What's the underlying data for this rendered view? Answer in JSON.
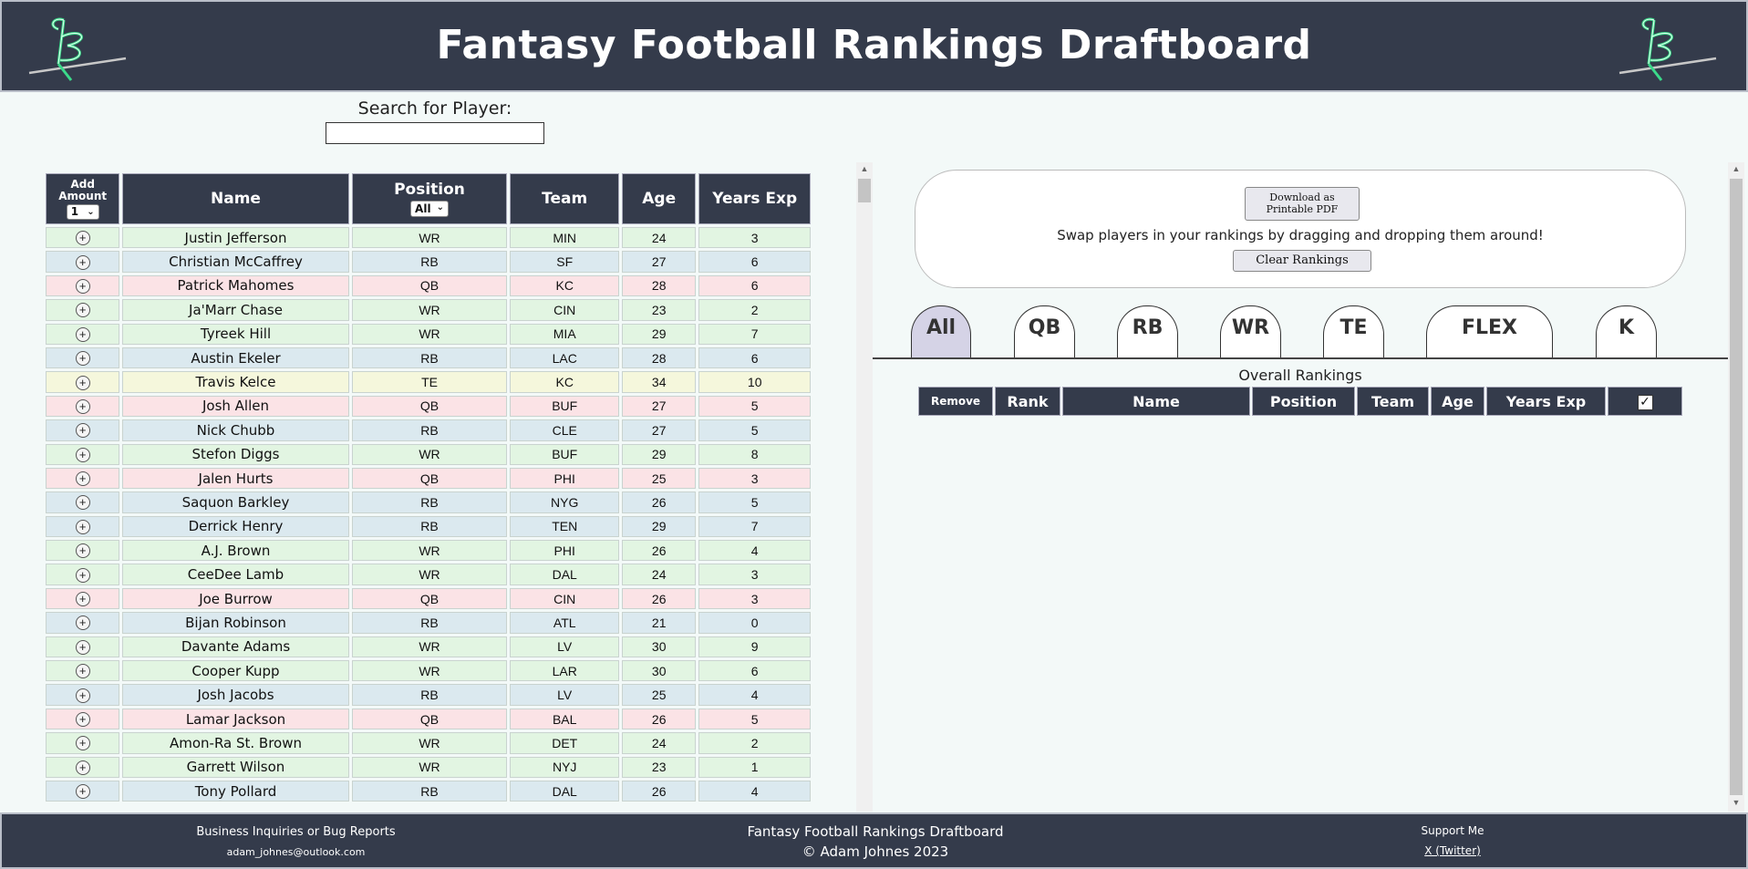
{
  "header": {
    "title": "Fantasy Football Rankings Draftboard"
  },
  "search": {
    "label": "Search for Player:",
    "value": "",
    "placeholder": ""
  },
  "player_table": {
    "headers": {
      "add_line1": "Add",
      "add_line2": "Amount",
      "name": "Name",
      "position": "Position",
      "team": "Team",
      "age": "Age",
      "years_exp": "Years Exp"
    },
    "add_amount_value": "1",
    "position_filter_value": "All",
    "add_icon": "plus-circle-icon",
    "rows": [
      {
        "name": "Justin Jefferson",
        "position": "WR",
        "team": "MIN",
        "age": "24",
        "exp": "3"
      },
      {
        "name": "Christian McCaffrey",
        "position": "RB",
        "team": "SF",
        "age": "27",
        "exp": "6"
      },
      {
        "name": "Patrick Mahomes",
        "position": "QB",
        "team": "KC",
        "age": "28",
        "exp": "6"
      },
      {
        "name": "Ja'Marr Chase",
        "position": "WR",
        "team": "CIN",
        "age": "23",
        "exp": "2"
      },
      {
        "name": "Tyreek Hill",
        "position": "WR",
        "team": "MIA",
        "age": "29",
        "exp": "7"
      },
      {
        "name": "Austin Ekeler",
        "position": "RB",
        "team": "LAC",
        "age": "28",
        "exp": "6"
      },
      {
        "name": "Travis Kelce",
        "position": "TE",
        "team": "KC",
        "age": "34",
        "exp": "10"
      },
      {
        "name": "Josh Allen",
        "position": "QB",
        "team": "BUF",
        "age": "27",
        "exp": "5"
      },
      {
        "name": "Nick Chubb",
        "position": "RB",
        "team": "CLE",
        "age": "27",
        "exp": "5"
      },
      {
        "name": "Stefon Diggs",
        "position": "WR",
        "team": "BUF",
        "age": "29",
        "exp": "8"
      },
      {
        "name": "Jalen Hurts",
        "position": "QB",
        "team": "PHI",
        "age": "25",
        "exp": "3"
      },
      {
        "name": "Saquon Barkley",
        "position": "RB",
        "team": "NYG",
        "age": "26",
        "exp": "5"
      },
      {
        "name": "Derrick Henry",
        "position": "RB",
        "team": "TEN",
        "age": "29",
        "exp": "7"
      },
      {
        "name": "A.J. Brown",
        "position": "WR",
        "team": "PHI",
        "age": "26",
        "exp": "4"
      },
      {
        "name": "CeeDee Lamb",
        "position": "WR",
        "team": "DAL",
        "age": "24",
        "exp": "3"
      },
      {
        "name": "Joe Burrow",
        "position": "QB",
        "team": "CIN",
        "age": "26",
        "exp": "3"
      },
      {
        "name": "Bijan Robinson",
        "position": "RB",
        "team": "ATL",
        "age": "21",
        "exp": "0"
      },
      {
        "name": "Davante Adams",
        "position": "WR",
        "team": "LV",
        "age": "30",
        "exp": "9"
      },
      {
        "name": "Cooper Kupp",
        "position": "WR",
        "team": "LAR",
        "age": "30",
        "exp": "6"
      },
      {
        "name": "Josh Jacobs",
        "position": "RB",
        "team": "LV",
        "age": "25",
        "exp": "4"
      },
      {
        "name": "Lamar Jackson",
        "position": "QB",
        "team": "BAL",
        "age": "26",
        "exp": "5"
      },
      {
        "name": "Amon-Ra St. Brown",
        "position": "WR",
        "team": "DET",
        "age": "24",
        "exp": "2"
      },
      {
        "name": "Garrett Wilson",
        "position": "WR",
        "team": "NYJ",
        "age": "23",
        "exp": "1"
      },
      {
        "name": "Tony Pollard",
        "position": "RB",
        "team": "DAL",
        "age": "26",
        "exp": "4"
      }
    ]
  },
  "rankings_panel": {
    "pdf_button_label": "Download as Printable PDF",
    "instructions": "Swap players in your rankings by dragging and dropping them around!",
    "clear_button_label": "Clear Rankings",
    "tabs": [
      "All",
      "QB",
      "RB",
      "WR",
      "TE",
      "FLEX",
      "K"
    ],
    "active_tab": "All",
    "table_title": "Overall Rankings",
    "table_headers": [
      "Remove",
      "Rank",
      "Name",
      "Position",
      "Team",
      "Age",
      "Years Exp"
    ],
    "check_icon": "checkbox-checked-icon"
  },
  "footer": {
    "contact_title": "Business Inquiries or Bug Reports",
    "contact_email": "adam_johnes@outlook.com",
    "center_title": "Fantasy Football Rankings Draftboard",
    "copyright": "© Adam Johnes 2023",
    "support_title": "Support Me",
    "support_link": "X (Twitter)"
  },
  "colors": {
    "header_bg": "#343b4b",
    "page_bg": "#f3f9f8",
    "wr_row": "#e2f5e2",
    "rb_row": "#dbe9ef",
    "qb_row": "#fbe3e6",
    "te_row": "#f5f7dc",
    "active_tab": "#d5d3e6",
    "logo_green": "#3bd98a"
  }
}
